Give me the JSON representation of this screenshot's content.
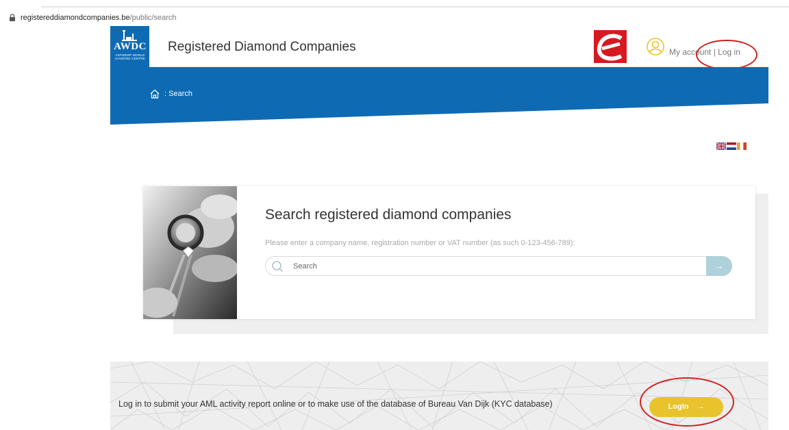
{
  "browser": {
    "url_domain": "registereddiamondcompanies.be",
    "url_path": "/public/search"
  },
  "header": {
    "logo_name": "AWDC",
    "logo_subtitle": "ANTWERP WORLD DIAMOND CENTRE",
    "site_title": "Registered Diamond Companies",
    "my_account_label": "My account",
    "separator": "|",
    "login_link_label": "Log in"
  },
  "breadcrumb": {
    "separator": ":",
    "current": "Search"
  },
  "search": {
    "title": "Search registered diamond companies",
    "description": "Please enter a company name, registration number or VAT number (as such 0-123-456-789):",
    "placeholder": "Search",
    "submit_glyph": "→"
  },
  "banner": {
    "text": "Log in to submit your AML activity report online or to make use of the database of Bureau Van Dijk (KYC database)",
    "button_label": "LogIn",
    "button_glyph": "→"
  },
  "colors": {
    "brand_blue": "#0e6bb3",
    "accent_yellow": "#e8c32c",
    "annotation_red": "#d21f1f",
    "search_button": "#aed2da"
  },
  "icons": {
    "lock": "lock-icon",
    "user": "user-circle-icon",
    "home": "home-icon",
    "search": "search-icon",
    "flags": [
      "uk-flag-icon",
      "netherlands-flag-icon",
      "france-flag-icon"
    ]
  }
}
